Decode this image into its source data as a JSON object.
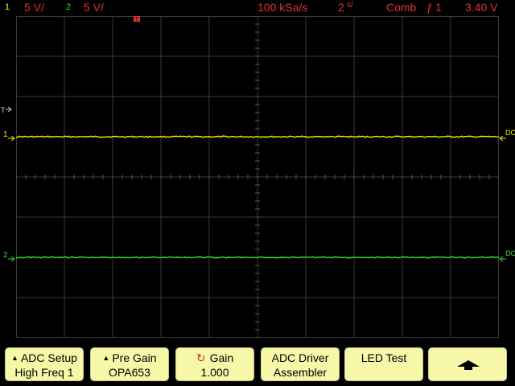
{
  "header": {
    "ch1_num": "1",
    "ch1_scale": "5 V/",
    "ch2_num": "2",
    "ch2_scale": "5 V/",
    "sample_rate": "100 kSa/s",
    "timebase": "2",
    "timebase_unit": "s/",
    "trigger_mode": "Comb",
    "trigger_source": "1",
    "trigger_level": "3.40 V"
  },
  "markers": {
    "trigger_marker": "T",
    "ch1_marker": "1",
    "ch2_marker": "2",
    "ch1_coupling": "DC",
    "ch2_coupling": "DC"
  },
  "softkeys": [
    {
      "line1": "ADC Setup",
      "line2": "High Freq 1",
      "icon": "triangle-up-icon"
    },
    {
      "line1": "Pre Gain",
      "line2": "OPA653",
      "icon": "triangle-up-icon"
    },
    {
      "line1": "Gain",
      "line2": "1.000",
      "icon": "rotary-knob-icon"
    },
    {
      "line1": "ADC Driver",
      "line2": "Assembler"
    },
    {
      "line1": "LED Test",
      "line2": ""
    },
    {
      "line1": "",
      "line2": "",
      "icon": "up-arrow-icon"
    }
  ],
  "colors": {
    "ch1": "#f0f000",
    "ch2": "#33dd33",
    "accent": "#e03030",
    "grid": "#3a3a3a",
    "softkey_bg": "#f7f7a8"
  },
  "traces": {
    "ch1_level_div": 5.0,
    "ch2_level_div": 2.0
  }
}
